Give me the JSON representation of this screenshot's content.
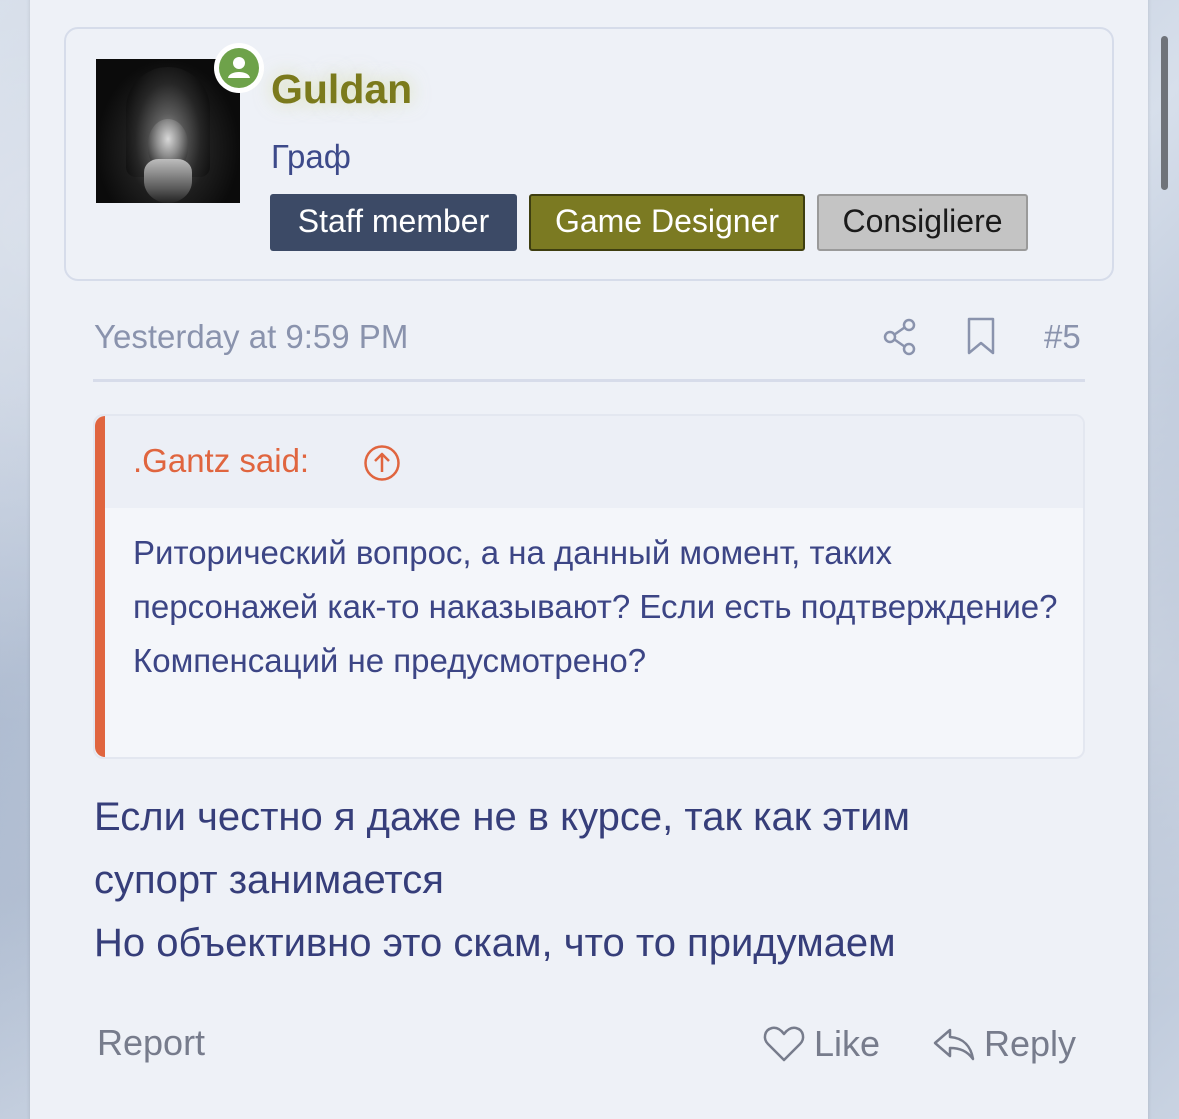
{
  "user": {
    "name": "Guldan",
    "title": "Граф",
    "online_icon": "user-online-icon",
    "banners": [
      "Staff member",
      "Game Designer",
      "Consigliere"
    ]
  },
  "post": {
    "date": "Yesterday at 9:59 PM",
    "number": "#5",
    "share_icon": "share-icon",
    "bookmark_icon": "bookmark-icon"
  },
  "quote": {
    "author": ".Gantz said:",
    "jump_icon": "arrow-up-circle-icon",
    "text": "Риторический вопрос, а на данный момент, таких персонажей как-то наказывают? Если есть подтверждение? Компенсаций не предусмотрено?"
  },
  "body": {
    "lines": [
      "Если честно я даже не в курсе, так как этим",
      "супорт занимается",
      "Но объективно это скам, что то придумаем"
    ]
  },
  "actions": {
    "report": "Report",
    "like": "Like",
    "reply": "Reply"
  },
  "colors": {
    "username": "#7b7a1c",
    "quote_accent": "#e0653f",
    "text": "#363e7a",
    "online": "#6ea24a"
  }
}
